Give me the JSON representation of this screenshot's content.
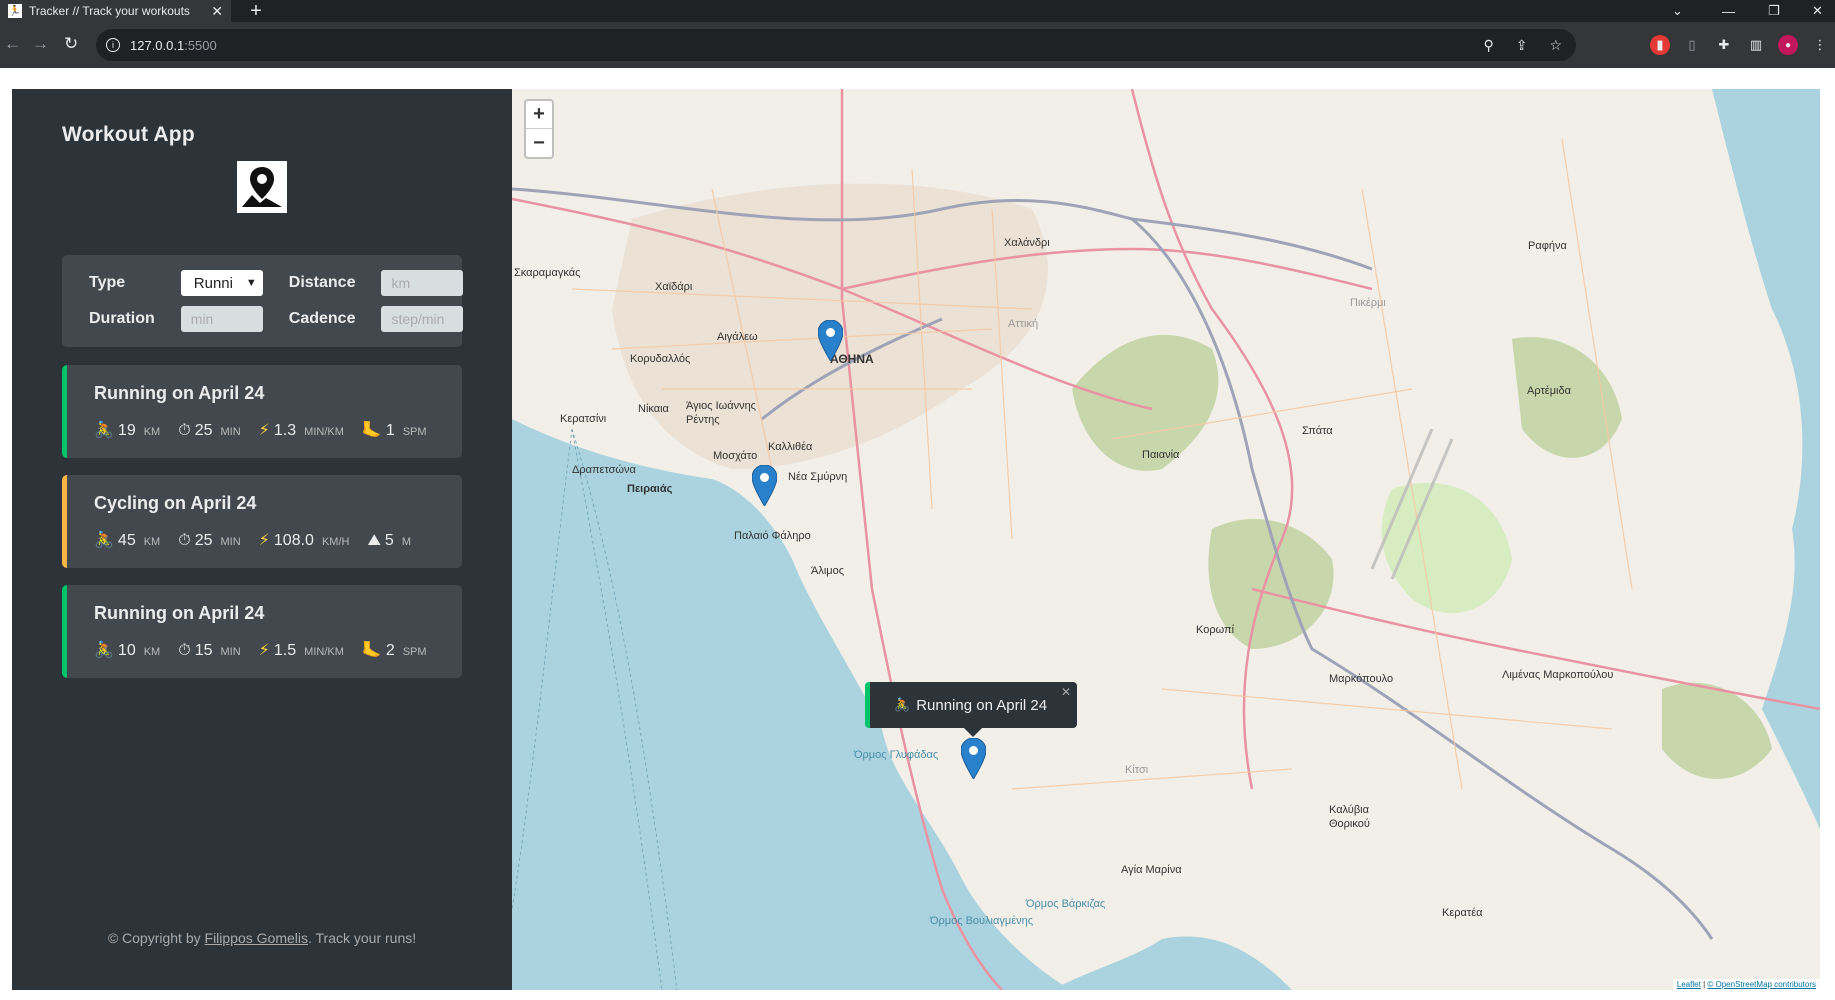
{
  "browser": {
    "tab_title": "Tracker // Track your workouts",
    "tab_icon": "running-figure-icon",
    "address_host": "127.0.0.1",
    "address_port": ":5500"
  },
  "app": {
    "title": "Workout App",
    "logo": "map-pin-logo-icon"
  },
  "form": {
    "type_label": "Type",
    "type_value": "Runni",
    "distance_label": "Distance",
    "distance_placeholder": "km",
    "duration_label": "Duration",
    "duration_placeholder": "min",
    "cadence_label": "Cadence",
    "cadence_placeholder": "step/min"
  },
  "workouts": [
    {
      "title": "Running on April 24",
      "type": "running",
      "distance": "19",
      "distance_unit": "km",
      "duration": "25",
      "duration_unit": "min",
      "pace": "1.3",
      "pace_unit": "min/km",
      "extra": "1",
      "extra_unit": "spm"
    },
    {
      "title": "Cycling on April 24",
      "type": "cycling",
      "distance": "45",
      "distance_unit": "km",
      "duration": "25",
      "duration_unit": "min",
      "pace": "108.0",
      "pace_unit": "km/h",
      "extra": "5",
      "extra_unit": "m"
    },
    {
      "title": "Running on April 24",
      "type": "running",
      "distance": "10",
      "distance_unit": "km",
      "duration": "15",
      "duration_unit": "min",
      "pace": "1.5",
      "pace_unit": "min/km",
      "extra": "2",
      "extra_unit": "spm"
    }
  ],
  "footer": {
    "prefix": "© Copyright by ",
    "author": "Filippos Gomelis",
    "suffix": ". Track your runs!"
  },
  "map": {
    "zoom_in": "+",
    "zoom_out": "−",
    "popup_text": "Running on April 24",
    "attribution_leaflet": "Leaflet",
    "attribution_osm": "© OpenStreetMap contributors",
    "places": [
      "Χαλάνδρι",
      "Σκαραμαγκάς",
      "Χαϊδάρι",
      "Αιγάλεω",
      "ΑΘΗΝΑ",
      "Κορυδαλλός",
      "Νίκαια",
      "Κερατσίνι",
      "Άγιος Ιωάννης Ρέντης",
      "Μοσχάτο",
      "Καλλιθέα",
      "Νέα Σμύρνη",
      "Πειραιάς",
      "Παλαιό Φάληρο",
      "Άλιμος",
      "Παιανία",
      "Σπάτα",
      "Αρτέμιδα",
      "Ραφήνα",
      "Κορωπί",
      "Μαρκόπουλο",
      "Λιμένας Μαρκοπούλου",
      "Όρμος Γλυφάδας",
      "Καλύβια Θορικού",
      "Αγία Μαρίνα",
      "Όρμος Βάρκιζας",
      "Όρμος Βουλιαγμένης",
      "Κερατέα",
      "Αττική",
      "Πικέρμι",
      "Κίτσι",
      "Δραπετσώνα"
    ]
  },
  "colors": {
    "sidebar_bg": "#2d3439",
    "card_bg": "#42484d",
    "running_accent": "#00c46a",
    "cycling_accent": "#ffb545",
    "sea": "#aad3df",
    "land": "#f2efe9",
    "marker": "#2a81cb"
  }
}
